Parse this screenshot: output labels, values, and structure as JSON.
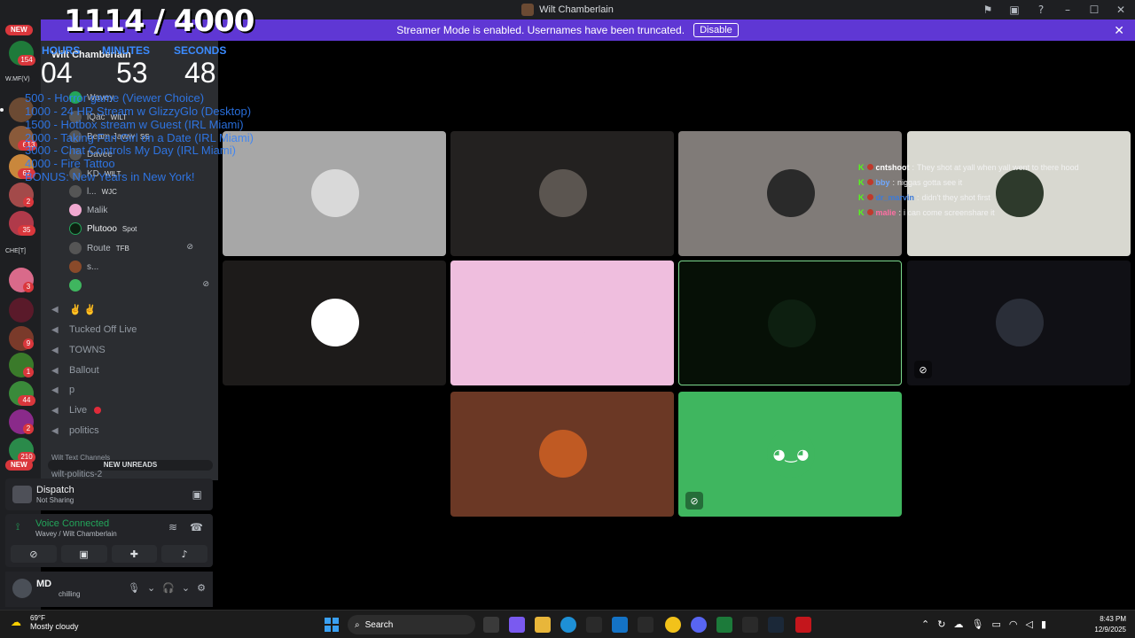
{
  "window": {
    "title": "Wilt Chamberlain"
  },
  "streamer_banner": {
    "message": "Streamer Mode is enabled. Usernames have been truncated.",
    "button": "Disable"
  },
  "rail": {
    "new_top": "NEW",
    "new_bottom": "NEW",
    "badges": [
      "154",
      "67",
      "13",
      "67",
      "2",
      "35",
      "3",
      "9",
      "1",
      "44",
      "2",
      "210"
    ],
    "labels": [
      "W.MF(V)",
      "CHE[T]"
    ]
  },
  "server": {
    "name": "Wilt Chamberlain",
    "category": "Wilt Text Channels",
    "text_channel": "wilt-politics-2",
    "new_unreads": "NEW UNREADS"
  },
  "voice_members": [
    {
      "name": "Wavey",
      "tag": ""
    },
    {
      "name": "lQac",
      "tag": "WILT"
    },
    {
      "name": "Beam Jaww",
      "tag": "SS"
    },
    {
      "name": "Davee",
      "tag": ""
    },
    {
      "name": "KD",
      "tag": "WILT"
    },
    {
      "name": "l...",
      "tag": "WJC"
    },
    {
      "name": "Malik",
      "tag": ""
    },
    {
      "name": "Plutooo",
      "tag": "Spot"
    },
    {
      "name": "Route",
      "tag": "TFB"
    },
    {
      "name": "s...",
      "tag": ""
    }
  ],
  "voice_channels": [
    "✌ ✌",
    "Tucked Off Live",
    "TOWNS",
    "Ballout",
    "p",
    "Live",
    "politics"
  ],
  "dispatch": {
    "name": "Dispatch",
    "status": "Not Sharing"
  },
  "voice_connection": {
    "status": "Voice Connected",
    "location": "Wavey / Wilt Chamberlain"
  },
  "user": {
    "name": "MD",
    "status": "chilling"
  },
  "overlay": {
    "counter": "1114 / 4000",
    "timer": {
      "hours_label": "HOURS",
      "minutes_label": "MINUTES",
      "seconds_label": "SECONDS",
      "hours": "04",
      "minutes": "53",
      "seconds": "48"
    },
    "goals": [
      "500 - Horror game (Viewer Choice)",
      "1000 - 24 HR Stream w GlizzyGlo (Desktop)",
      "1500 - Hotbox stream w Guest (IRL Miami)",
      "2000 - Taking Fan Girl on a Date (IRL Miami)",
      "3000 - Chat Controls My Day (IRL Miami)",
      "4000 - Fire Tattoo",
      "BONUS: New Years in New York!"
    ]
  },
  "chat": [
    {
      "user": "cntshoot",
      "color": "#ffffff",
      "message": "They shot at yall when yall went to there hood"
    },
    {
      "user": "bby",
      "color": "#6fa8ff",
      "message": "niggas gotta see it"
    },
    {
      "user": "dr_marvin",
      "color": "#3d7bd9",
      "message": "didn't they shot first"
    },
    {
      "user": "malie",
      "color": "#ff6fa3",
      "message": "i can come screenshare it"
    }
  ],
  "tiles": [
    {
      "name": "tile-1",
      "bg": "#a7a7a7",
      "avatar": "#d9d9d9"
    },
    {
      "name": "tile-2",
      "bg": "#232120",
      "avatar": "#5b5550"
    },
    {
      "name": "tile-3",
      "bg": "#807b78",
      "avatar": "#2a2a2a"
    },
    {
      "name": "tile-4",
      "bg": "#d8d8d0",
      "avatar": "#2e3a2c"
    },
    {
      "name": "tile-5",
      "bg": "#1d1b1a",
      "avatar": "#ffffff"
    },
    {
      "name": "tile-6",
      "bg": "#efbede",
      "avatar": "#efbede"
    },
    {
      "name": "tile-7",
      "bg": "#061006",
      "avatar": "#0d1f10"
    },
    {
      "name": "tile-8",
      "bg": "#101015",
      "avatar": "#2a2e38"
    },
    {
      "name": "tile-9",
      "bg": "#6b3825",
      "avatar": "#c05a23"
    },
    {
      "name": "tile-10",
      "bg": "#3fb65f",
      "avatar": "#3fb65f"
    }
  ],
  "taskbar": {
    "temp": "69°F",
    "weather": "Mostly cloudy",
    "search": "Search",
    "time": "8:43 PM",
    "date": "12/9/2025"
  }
}
